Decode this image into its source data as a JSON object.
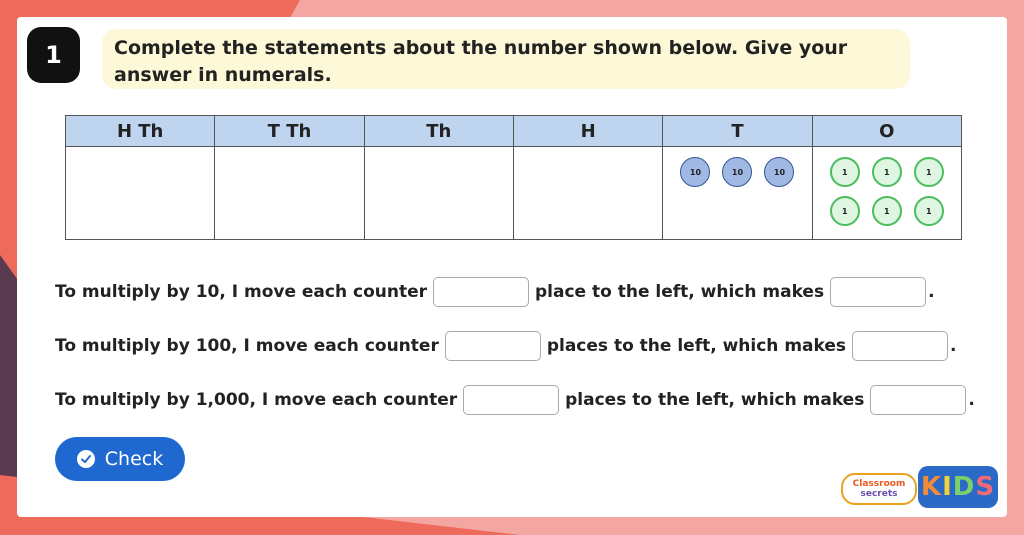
{
  "question": {
    "number": "1",
    "prompt": "Complete the statements about the number shown below. Give your answer in numerals."
  },
  "place_value_table": {
    "headers": [
      "H Th",
      "T Th",
      "Th",
      "H",
      "T",
      "O"
    ],
    "tens_counters": [
      "10",
      "10",
      "10"
    ],
    "ones_counters": [
      "1",
      "1",
      "1",
      "1",
      "1",
      "1"
    ]
  },
  "statements": [
    {
      "before": "To multiply by 10, I move each counter",
      "middle": "place to the left, which makes",
      "end": "."
    },
    {
      "before": "To multiply by 100, I move each counter",
      "middle": "places to the left, which makes",
      "end": "."
    },
    {
      "before": "To multiply by 1,000, I move each counter",
      "middle": "places to the left, which makes",
      "end": "."
    }
  ],
  "check_button": {
    "label": "Check",
    "icon": "check-circle-icon"
  },
  "branding": {
    "classroom_line1": "Classroom",
    "classroom_line2": "secrets",
    "kids": [
      "K",
      "I",
      "D",
      "S"
    ]
  },
  "colors": {
    "background": "#f4a6a2",
    "accent_orange": "#ee6b5c",
    "accent_dark": "#5a3a4f",
    "prompt_bg": "#fdf9d8",
    "header_bg": "#bfd4ee",
    "ten_counter": "#9fb9e4",
    "one_counter": "#dff6e3",
    "button": "#1f68d0"
  }
}
